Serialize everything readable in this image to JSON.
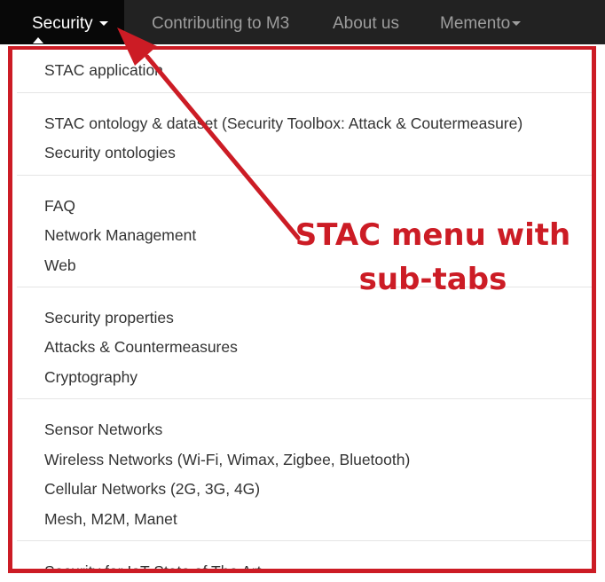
{
  "navbar": {
    "items": [
      {
        "label": "Security"
      },
      {
        "label": "Contributing to M3"
      },
      {
        "label": "About us"
      },
      {
        "label": "Memento"
      }
    ]
  },
  "dropdown": {
    "items": [
      "STAC application",
      "STAC ontology & dataset (Security Toolbox: Attack & Coutermeasure)",
      "Security ontologies",
      "FAQ",
      "Network Management",
      "Web",
      "Security properties",
      "Attacks & Countermeasures",
      "Cryptography",
      "Sensor Networks",
      "Wireless Networks (Wi-Fi, Wimax, Zigbee, Bluetooth)",
      "Cellular Networks (2G, 3G, 4G)",
      "Mesh, M2M, Manet",
      "Security for IoT State of The Art"
    ]
  },
  "annotation": {
    "line1": "STAC menu with",
    "line2": "sub-tabs",
    "color": "#cc1c25"
  }
}
